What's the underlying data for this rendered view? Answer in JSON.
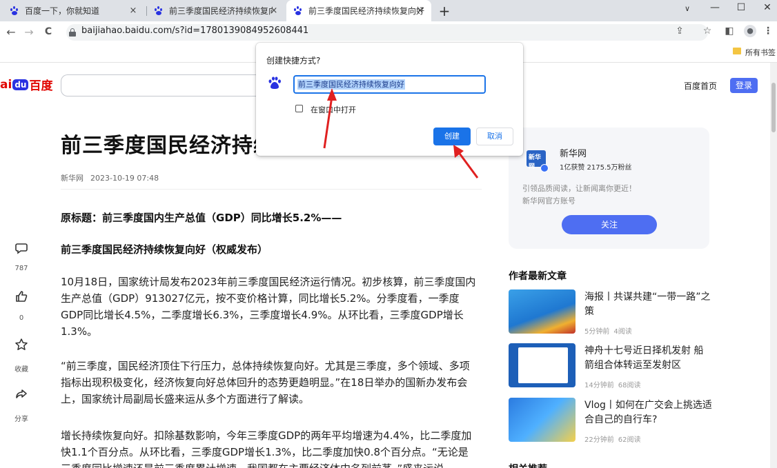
{
  "tabs": [
    {
      "label": "百度一下，你就知道",
      "close": "×"
    },
    {
      "label": "前三季度国民经济持续恢复向好",
      "close": "×"
    },
    {
      "label": "前三季度国民经济持续恢复向好",
      "close": "×"
    }
  ],
  "new_tab": "+",
  "window_controls": {
    "dropdown": "∨",
    "minimize": "—",
    "maximize": "☐",
    "close": "✕"
  },
  "toolbar": {
    "back": "←",
    "forward": "→",
    "reload": "C",
    "url": "baijiahao.baidu.com/s?id=1780139084952608441",
    "share": "⇪",
    "star": "☆",
    "sidepanel": "◧",
    "menu": "⋮"
  },
  "bookmarks": {
    "all_bookmarks": "所有书签"
  },
  "header": {
    "logo_bai": "ai",
    "logo_du": "du",
    "logo_baidu": "百度",
    "home_link": "百度首页",
    "login": "登录"
  },
  "article": {
    "title": "前三季度国民经济持续恢复向好",
    "source": "新华网",
    "date": "2023-10-19 07:48",
    "original_title": "原标题：前三季度国内生产总值（GDP）同比增长5.2%——",
    "subtitle": "前三季度国民经济持续恢复向好（权威发布）",
    "para1": "10月18日，国家统计局发布2023年前三季度国民经济运行情况。初步核算，前三季度国内生产总值（GDP）913027亿元，按不变价格计算，同比增长5.2%。分季度看，一季度GDP同比增长4.5%，二季度增长6.3%，三季度增长4.9%。从环比看，三季度GDP增长1.3%。",
    "para2": "“前三季度，国民经济顶住下行压力，总体持续恢复向好。尤其是三季度，多个领域、多项指标出现积极变化，经济恢复向好总体回升的态势更趋明显。”在18日举办的国新办发布会上，国家统计局副局长盛来运从多个方面进行了解读。",
    "para3": "增长持续恢复向好。扣除基数影响，今年三季度GDP的两年平均增速为4.4%，比二季度加快1.1个百分点。从环比看，三季度GDP增长1.3%，比二季度加快0.8个百分点。“无论是三季度同比增速还是前三季度累计增速，我国都在主要经济体中名列前茅。”盛来运说。"
  },
  "rail": {
    "comment_count": "787",
    "like_count": "0",
    "favorite": "收藏",
    "share": "分享"
  },
  "author_card": {
    "logo_text": "新华网",
    "name": "新华网",
    "stats": "1亿获赞 2175.5万粉丝",
    "desc1": "引领品质阅读，让新闻离你更近！",
    "desc2": "新华网官方账号",
    "follow": "关注"
  },
  "latest": {
    "heading": "作者最新文章",
    "items": [
      {
        "title": "海报丨共谋共建“一带一路”之策",
        "time": "5分钟前",
        "reads": "4阅读"
      },
      {
        "title": "神舟十七号近日择机发射 船箭组合体转运至发射区",
        "time": "14分钟前",
        "reads": "68阅读"
      },
      {
        "title": "Vlog丨如何在广交会上挑选适合自己的自行车?",
        "time": "22分钟前",
        "reads": "62阅读"
      }
    ]
  },
  "related_heading": "相关推荐",
  "dialog": {
    "title": "创建快捷方式?",
    "input_value": "前三季度国民经济持续恢复向好",
    "checkbox_label": "在窗口中打开",
    "create": "创建",
    "cancel": "取消"
  },
  "colors": {
    "accent": "#1a73e8",
    "baidu_blue": "#4e6ef2",
    "annotation": "#e02020"
  }
}
